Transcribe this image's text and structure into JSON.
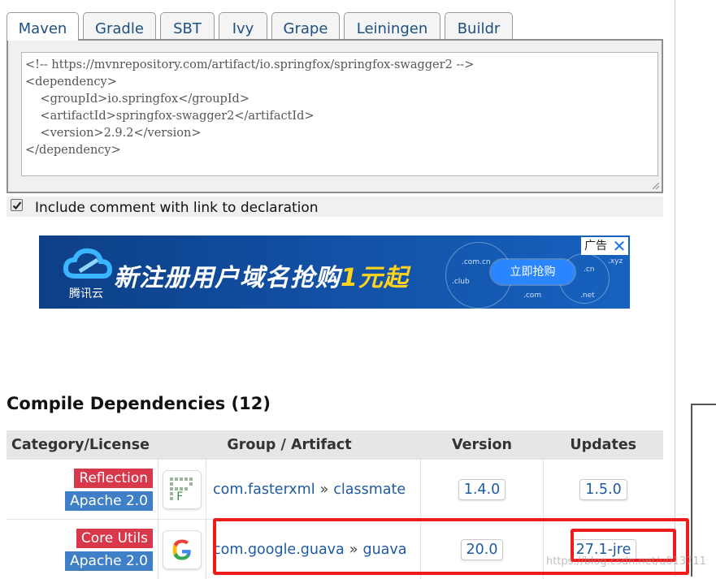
{
  "tabs": [
    "Maven",
    "Gradle",
    "SBT",
    "Ivy",
    "Grape",
    "Leiningen",
    "Buildr"
  ],
  "active_tab": "Maven",
  "code": {
    "text": "<!-- https://mvnrepository.com/artifact/io.springfox/springfox-swagger2 -->\n<dependency>\n    <groupId>io.springfox</groupId>\n    <artifactId>springfox-swagger2</artifactId>\n    <version>2.9.2</version>\n</dependency>"
  },
  "comment_option": {
    "label": "Include comment with link to declaration",
    "checked": true
  },
  "ad": {
    "brand": "腾讯云",
    "headline_prefix": "新注册用户域名抢购",
    "headline_highlight": "1元起",
    "cta": "立即抢购",
    "ad_tag": "广告",
    "close": "✕",
    "domains": [
      ".com.cn",
      ".cn",
      ".xyz",
      ".club",
      ".com",
      ".net"
    ]
  },
  "compile_dependencies": {
    "title": "Compile Dependencies (12)",
    "columns": [
      "Category/License",
      "Group / Artifact",
      "Version",
      "Updates"
    ],
    "rows": [
      {
        "category": "Reflection",
        "license": "Apache 2.0",
        "logo_icon": "fasterxml-classmate-logo",
        "group": "com.fasterxml",
        "separator": "»",
        "artifact": "classmate",
        "version": "1.4.0",
        "update": "1.5.0"
      },
      {
        "category": "Core Utils",
        "license": "Apache 2.0",
        "logo_icon": "google-g-logo",
        "group": "com.google.guava",
        "separator": "»",
        "artifact": "guava",
        "version": "20.0",
        "update": "27.1-jre"
      }
    ]
  },
  "watermark": "https://blog.csdn.net/u013711",
  "colors": {
    "link": "#1e5aa0",
    "badge_red": "#d9384a",
    "badge_blue": "#3f7fc8",
    "highlight_box": "#ee1c1c"
  }
}
